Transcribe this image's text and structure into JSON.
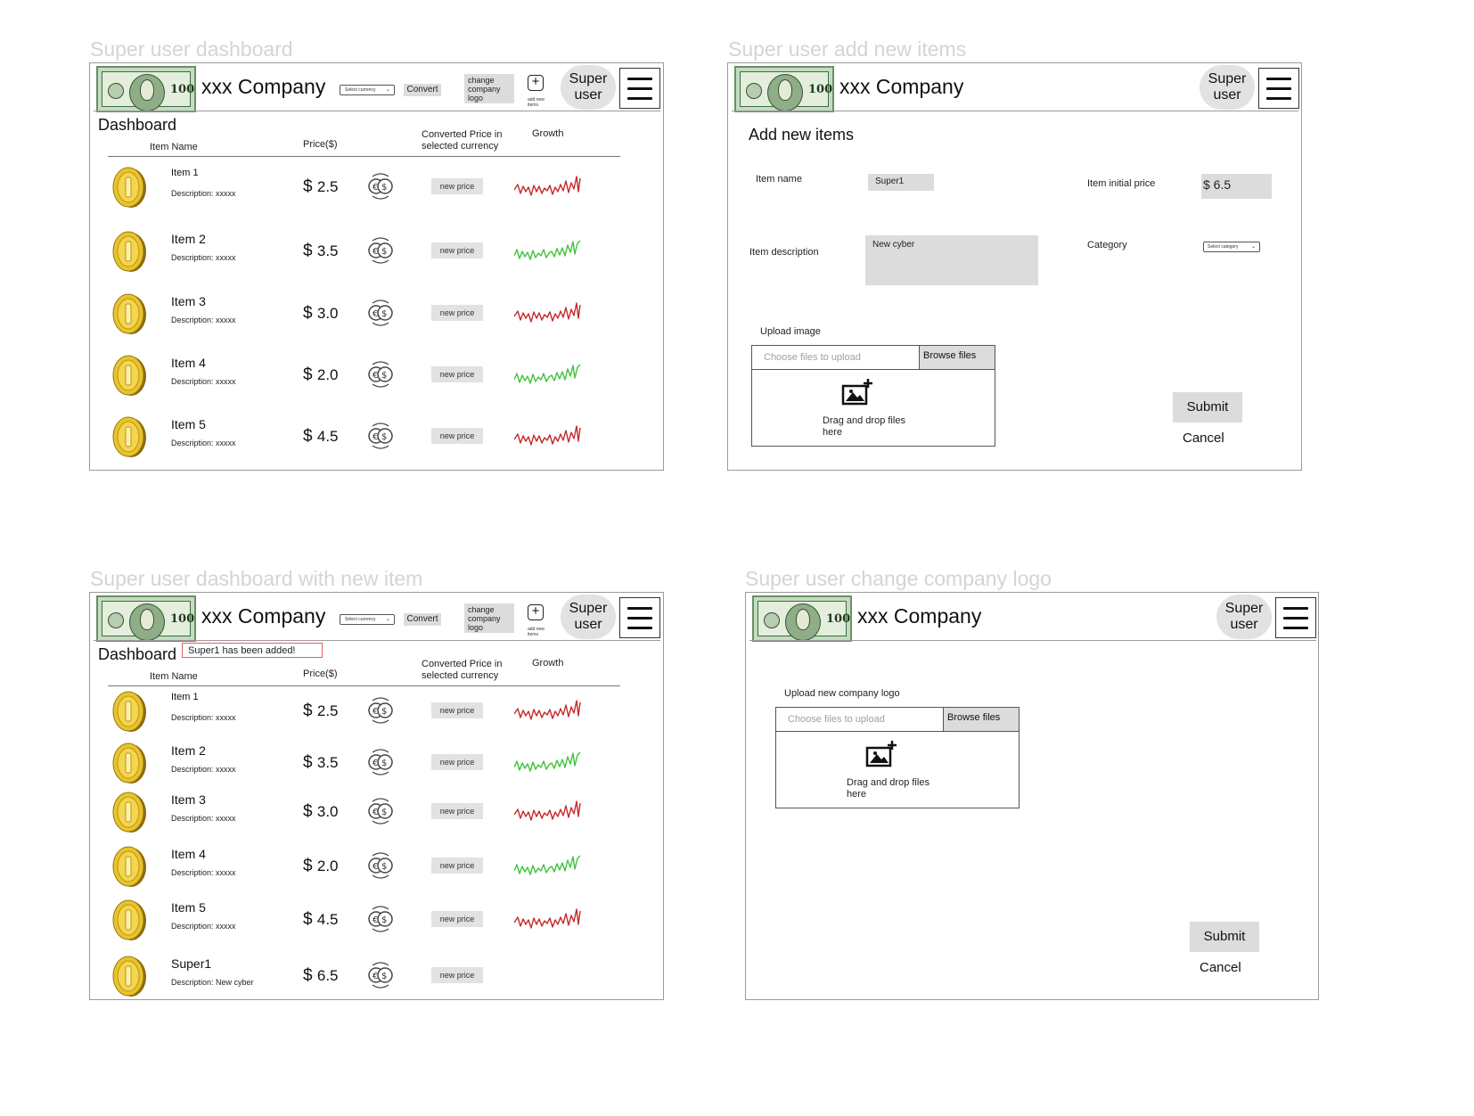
{
  "sections": {
    "dashboard": "Super user dashboard",
    "add_items": "Super user add new items",
    "dashboard_new": "Super user dashboard with new item",
    "change_logo": "Super user change company logo"
  },
  "header": {
    "company": "xxx Company",
    "select_currency": "Select currency",
    "convert": "Convert",
    "change_logo": "change company logo",
    "add_new_items": "add new items",
    "user": "Super user",
    "logo_value": "100"
  },
  "dashboard": {
    "title": "Dashboard",
    "columns": {
      "item_name": "Item Name",
      "price": "Price($)",
      "converted": "Converted Price in selected currency",
      "growth": "Growth"
    },
    "new_price_label": "new price",
    "items": [
      {
        "name": "Item 1",
        "desc": "Description: xxxxx",
        "price": "2.5",
        "growth": "down"
      },
      {
        "name": "Item 2",
        "desc": "Description: xxxxx",
        "price": "3.5",
        "growth": "up"
      },
      {
        "name": "Item 3",
        "desc": "Description: xxxxx",
        "price": "3.0",
        "growth": "down"
      },
      {
        "name": "Item 4",
        "desc": "Description: xxxxx",
        "price": "2.0",
        "growth": "up"
      },
      {
        "name": "Item 5",
        "desc": "Description: xxxxx",
        "price": "4.5",
        "growth": "down"
      }
    ],
    "new_item": {
      "name": "Super1",
      "desc": "Description: New cyber",
      "price": "6.5"
    },
    "toast": "Super1 has been added!"
  },
  "add_form": {
    "title": "Add new items",
    "item_name_label": "Item name",
    "item_name_value": "Super1",
    "item_price_label": "Item initial price",
    "item_price_value": "$ 6.5",
    "item_desc_label": "Item description",
    "item_desc_value": "New cyber",
    "category_label": "Category",
    "category_placeholder": "Select category",
    "upload_label": "Upload image",
    "choose_placeholder": "Choose files to upload",
    "browse": "Browse files",
    "drop_line1": "Drag and drop files",
    "drop_line2": "here",
    "submit": "Submit",
    "cancel": "Cancel"
  },
  "logo_form": {
    "upload_label": "Upload new company logo",
    "choose_placeholder": "Choose files to upload",
    "browse": "Browse files",
    "drop_line1": "Drag and drop files",
    "drop_line2": "here",
    "submit": "Submit",
    "cancel": "Cancel"
  },
  "colors": {
    "growth_up": "#3fc33a",
    "growth_down": "#c42a2a",
    "button_gray": "#dcdcdc",
    "toast_border": "#e06060"
  }
}
